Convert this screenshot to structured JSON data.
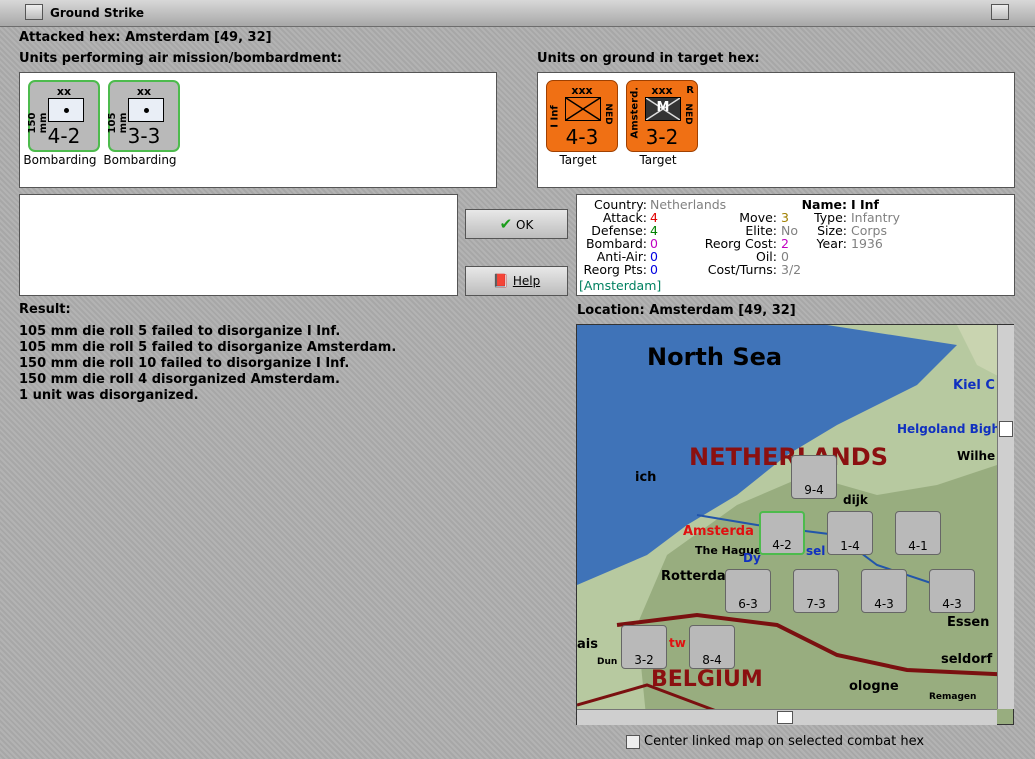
{
  "window": {
    "title": "Ground Strike"
  },
  "attacked_hex": "Attacked hex: Amsterdam  [49, 32]",
  "air_units_label": "Units performing air mission/bombardment:",
  "ground_units_label": "Units on ground in target hex:",
  "air_units": [
    {
      "top": "xx",
      "side": "150 mm",
      "strength": "4-2",
      "status": "Bombarding"
    },
    {
      "top": "xx",
      "side": "105 mm",
      "strength": "3-3",
      "status": "Bombarding"
    }
  ],
  "ground_units": [
    {
      "top": "xxx",
      "side": "I Inf",
      "rside": "NED",
      "strength": "4-3",
      "status": "Target"
    },
    {
      "top": "xxx",
      "side": "Amsterd.",
      "rside": "NED",
      "corner": "R",
      "symbol": "M",
      "strength": "3-2",
      "status": "Target"
    }
  ],
  "buttons": {
    "ok": "OK",
    "help": "Help"
  },
  "info": {
    "country_k": "Country:",
    "country_v": "Netherlands",
    "attack_k": "Attack:",
    "attack_v": "4",
    "defense_k": "Defense:",
    "defense_v": "4",
    "bombard_k": "Bombard:",
    "bombard_v": "0",
    "antiair_k": "Anti-Air:",
    "antiair_v": "0",
    "reorgpts_k": "Reorg Pts:",
    "reorgpts_v": "0",
    "location_v": "[Amsterdam]",
    "move_k": "Move:",
    "move_v": "3",
    "elite_k": "Elite:",
    "elite_v": "No",
    "reorgcost_k": "Reorg Cost:",
    "reorgcost_v": "2",
    "oil_k": "Oil:",
    "oil_v": "0",
    "costturns_k": "Cost/Turns:",
    "costturns_v": "3/2",
    "name_k": "Name:",
    "name_v": "I Inf",
    "type_k": "Type:",
    "type_v": "Infantry",
    "size_k": "Size:",
    "size_v": "Corps",
    "year_k": "Year:",
    "year_v": "1936"
  },
  "result_label": "Result:",
  "results": [
    "105 mm die roll 5 failed to disorganize I Inf.",
    "105 mm die roll 5 failed to disorganize Amsterdam.",
    "150 mm die roll 10 failed to disorganize I Inf.",
    "150 mm die roll 4 disorganized Amsterdam.",
    "1 unit was disorganized."
  ],
  "location_label": "Location:  Amsterdam  [49, 32]",
  "map": {
    "labels": {
      "sea": "North Sea",
      "country1": "NETHERLANDS",
      "country2": "BELGIUM",
      "kiel": "Kiel C",
      "helgoland": "Helgoland Bight",
      "wilhelm": "Wilhe",
      "amsterdam": "Amsterda",
      "hague": "The Hague",
      "rotterdam": "Rotterda",
      "dijk": "dijk",
      "essen": "Essen",
      "seldorf": "seldorf",
      "cologne": "ologne",
      "remagen": "Remagen",
      "ich": "ich",
      "ais": "ais",
      "dy": "Dy",
      "sel": "sel",
      "dun": "Dun",
      "tw": "tw"
    },
    "units": [
      {
        "s": "9-4"
      },
      {
        "s": "1-4"
      },
      {
        "s": "4-1"
      },
      {
        "s": "4-2"
      },
      {
        "s": "6-3"
      },
      {
        "s": "7-3"
      },
      {
        "s": "4-3"
      },
      {
        "s": "4-3"
      },
      {
        "s": "3-2"
      },
      {
        "s": "8-4"
      }
    ]
  },
  "center_map_label": "Center linked map on selected combat hex",
  "colors": {
    "attack": "#e00000",
    "defense": "#008000",
    "bombard": "#c000c0",
    "antiair": "#0000e0",
    "move": "#a08000",
    "location": "#008060"
  }
}
